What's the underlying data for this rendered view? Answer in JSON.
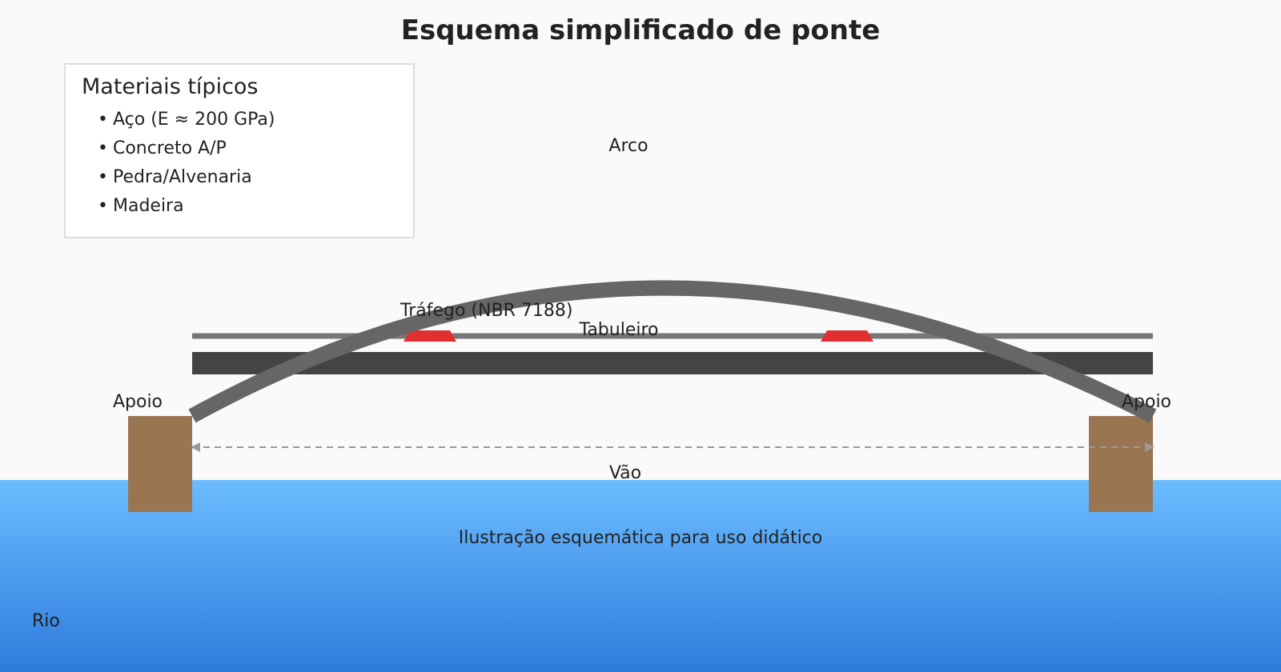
{
  "title": "Esquema simplificado de ponte",
  "materials": {
    "title": "Materiais típicos",
    "items": [
      "Aço (E ≈ 200 GPa)",
      "Concreto A/P",
      "Pedra/Alvenaria",
      "Madeira"
    ]
  },
  "labels": {
    "arch": "Arco",
    "traffic": "Tráfego (NBR 7188)",
    "deck": "Tabuleiro",
    "support_left": "Apoio",
    "support_right": "Apoio",
    "span": "Vão",
    "caption": "Ilustração esquemática para uso didático",
    "river": "Rio"
  },
  "colors": {
    "background": "#fafafa",
    "water_top": "#6bbcff",
    "water_bottom": "#2f7bdd",
    "deck": "#444444",
    "arch": "#666666",
    "traffic_lane": "#777777",
    "vehicle": "#e03030",
    "support": "#9a7552",
    "dimension_line": "#999999",
    "text": "#222222"
  }
}
